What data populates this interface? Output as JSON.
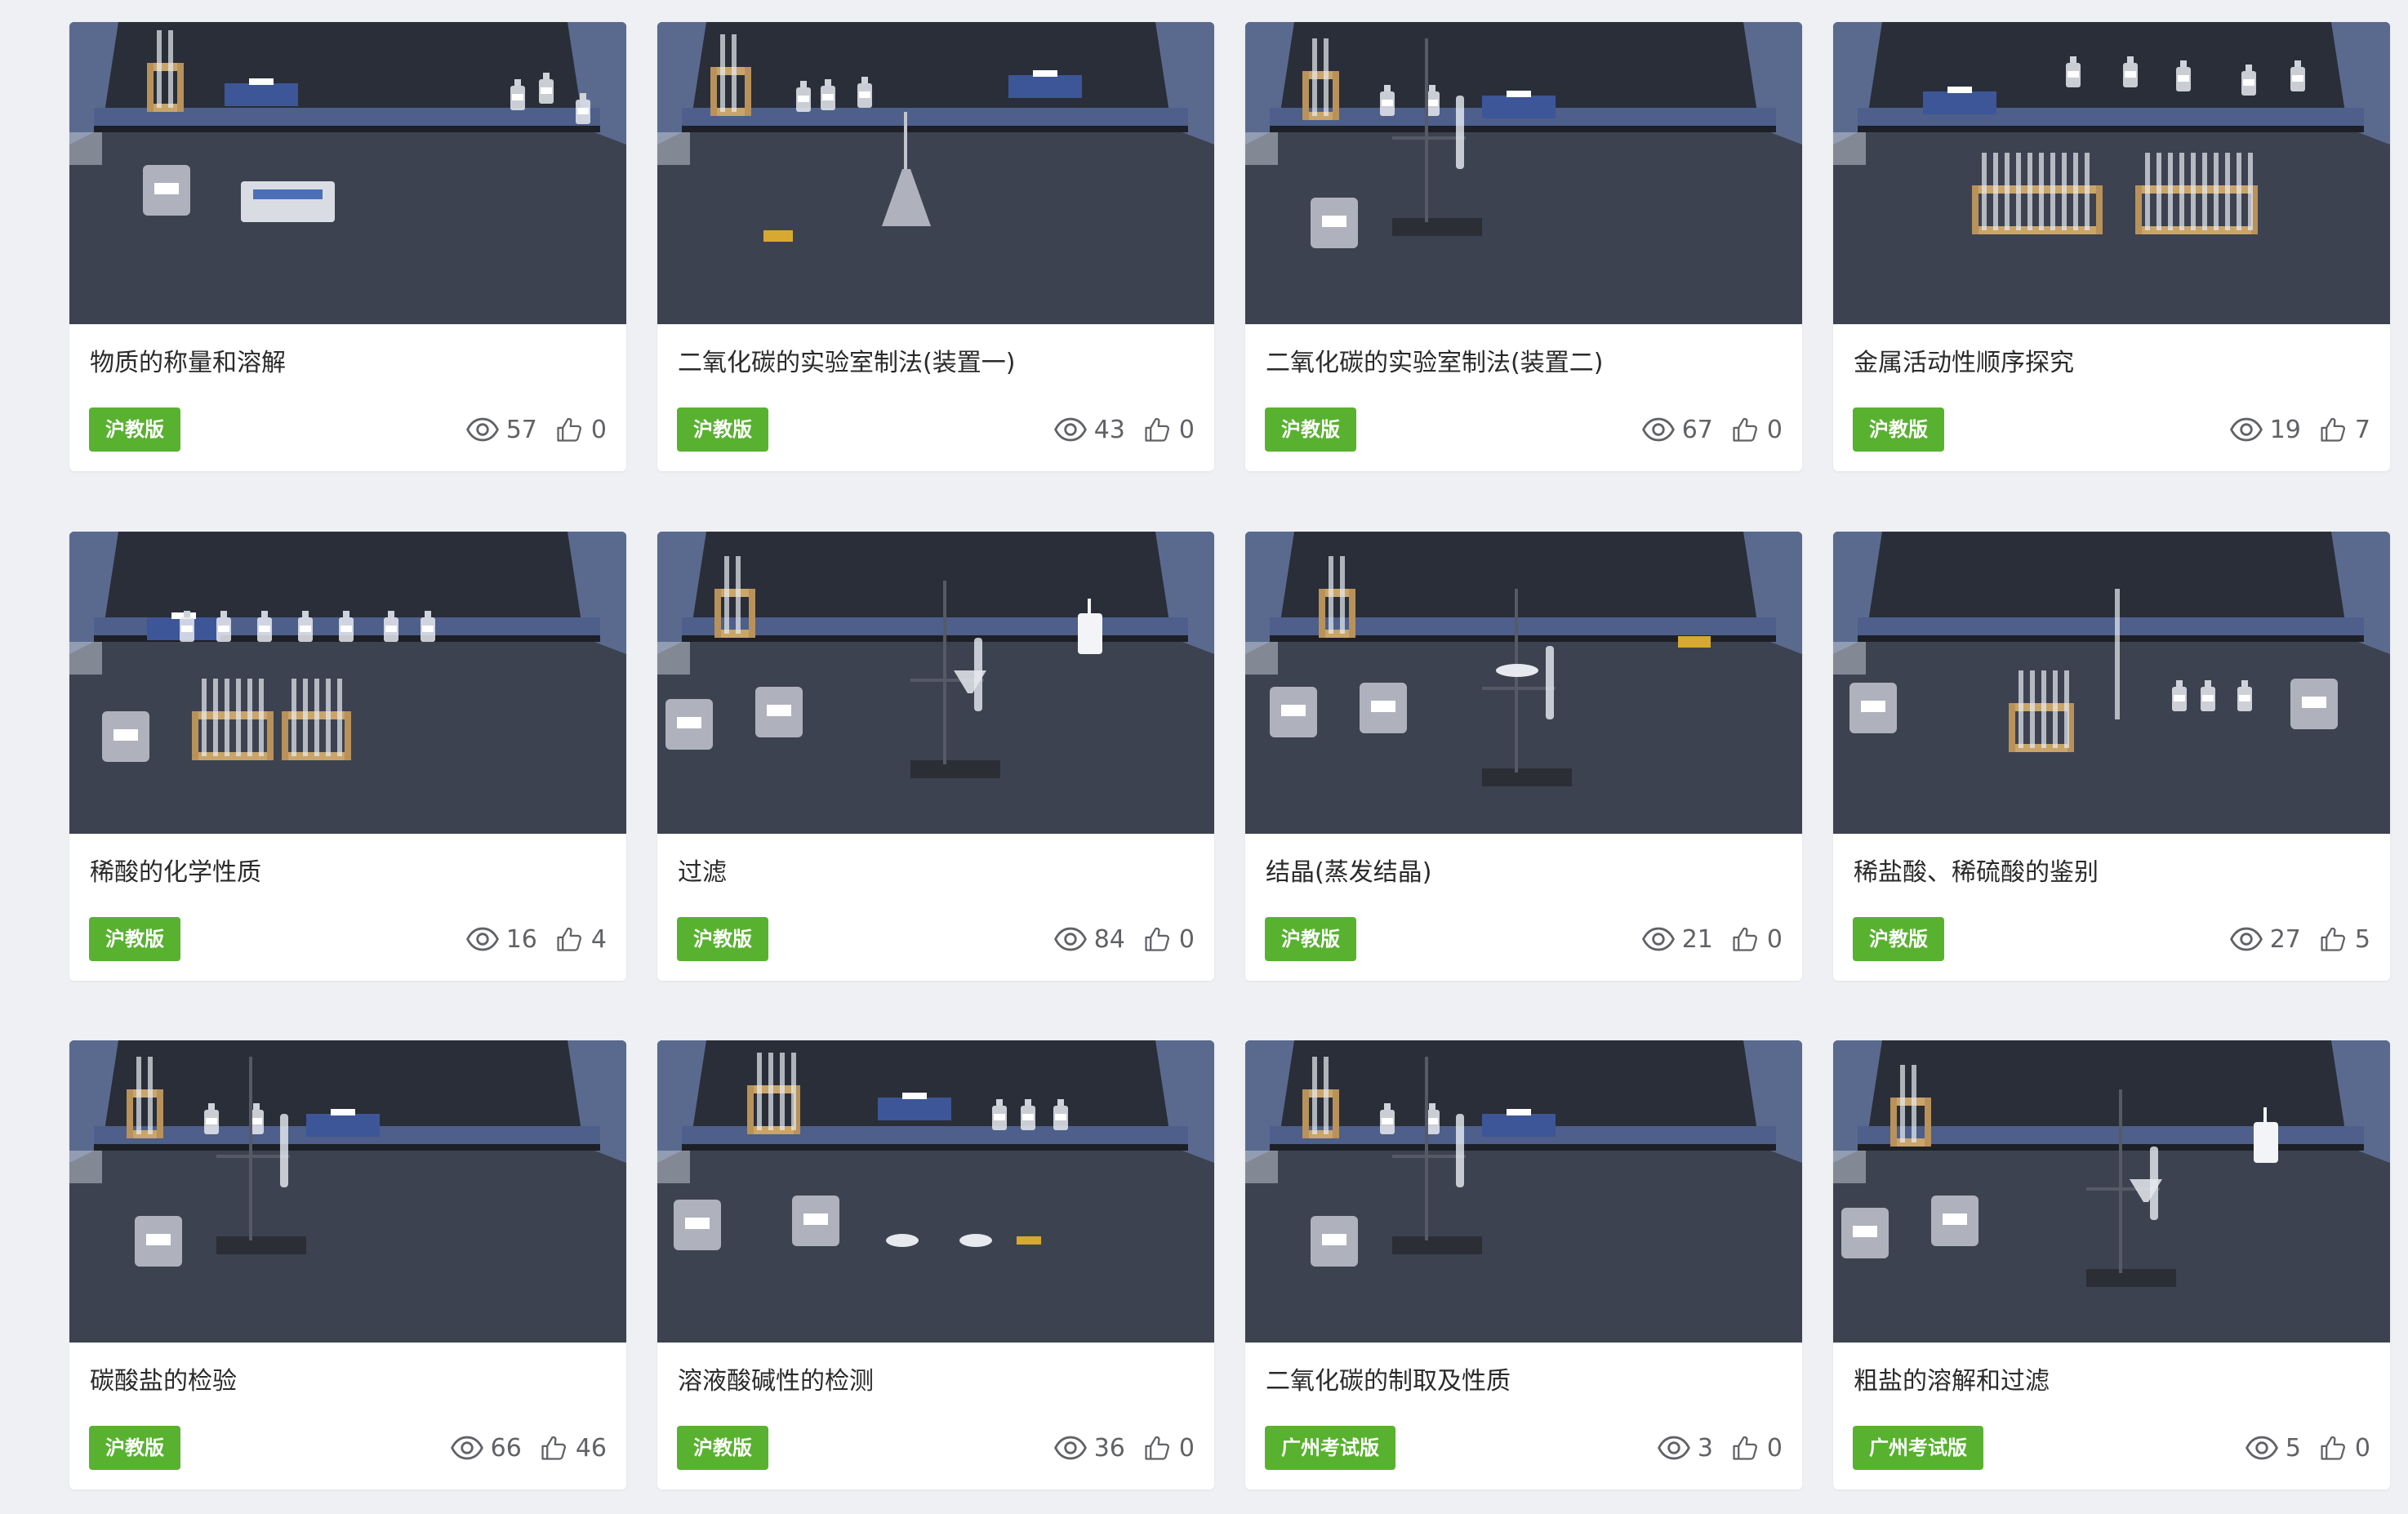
{
  "colors": {
    "page_background": "#eef0f4",
    "badge_green": "#59b130",
    "card_background": "#ffffff",
    "title_text": "#2a2a2a",
    "stat_text": "#606266"
  },
  "experiments": [
    {
      "title": "物质的称量和溶解",
      "badge": "沪教版",
      "views": "57",
      "likes": "0",
      "scene": "scale"
    },
    {
      "title": "二氧化碳的实验室制法(装置一)",
      "badge": "沪教版",
      "views": "43",
      "likes": "0",
      "scene": "flask"
    },
    {
      "title": "二氧化碳的实验室制法(装置二)",
      "badge": "沪教版",
      "views": "67",
      "likes": "0",
      "scene": "stand"
    },
    {
      "title": "金属活动性顺序探究",
      "badge": "沪教版",
      "views": "19",
      "likes": "7",
      "scene": "racks"
    },
    {
      "title": "稀酸的化学性质",
      "badge": "沪教版",
      "views": "16",
      "likes": "4",
      "scene": "racks-small"
    },
    {
      "title": "过滤",
      "badge": "沪教版",
      "views": "84",
      "likes": "0",
      "scene": "filter"
    },
    {
      "title": "结晶(蒸发结晶)",
      "badge": "沪教版",
      "views": "21",
      "likes": "0",
      "scene": "evaporate"
    },
    {
      "title": "稀盐酸、稀硫酸的鉴别",
      "badge": "沪教版",
      "views": "27",
      "likes": "5",
      "scene": "dropper"
    },
    {
      "title": "碳酸盐的检验",
      "badge": "沪教版",
      "views": "66",
      "likes": "46",
      "scene": "stand"
    },
    {
      "title": "溶液酸碱性的检测",
      "badge": "沪教版",
      "views": "36",
      "likes": "0",
      "scene": "dishes"
    },
    {
      "title": "二氧化碳的制取及性质",
      "badge": "广州考试版",
      "views": "3",
      "likes": "0",
      "scene": "stand"
    },
    {
      "title": "粗盐的溶解和过滤",
      "badge": "广州考试版",
      "views": "5",
      "likes": "0",
      "scene": "filter"
    }
  ]
}
